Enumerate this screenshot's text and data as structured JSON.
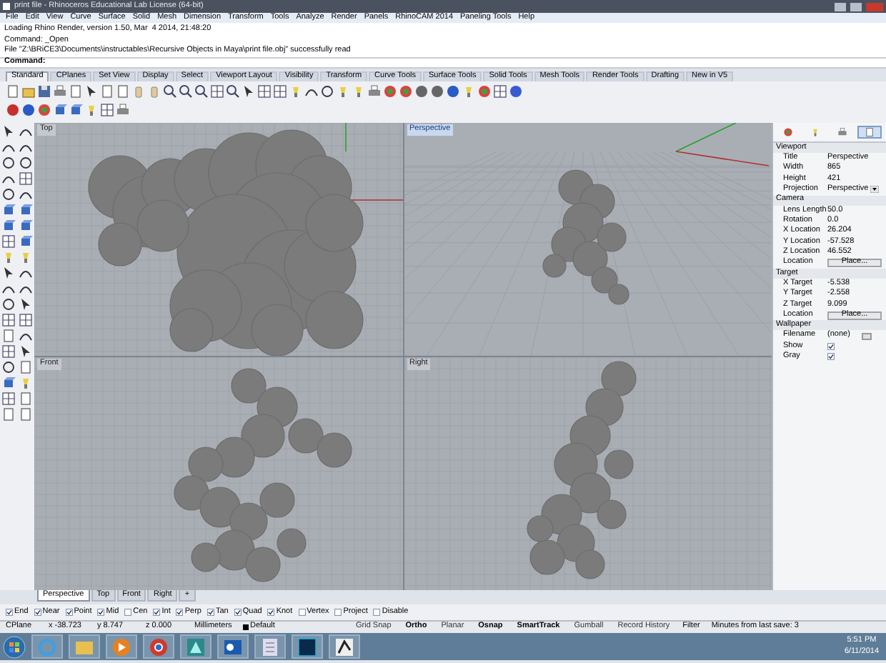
{
  "window": {
    "title": "print file - Rhinoceros Educational Lab License (64-bit)"
  },
  "menu": [
    "File",
    "Edit",
    "View",
    "Curve",
    "Surface",
    "Solid",
    "Mesh",
    "Dimension",
    "Transform",
    "Tools",
    "Analyze",
    "Render",
    "Panels",
    "RhinoCAM 2014",
    "Paneling Tools",
    "Help"
  ],
  "command_history": [
    "Loading Rhino Render, version 1.50, Mar  4 2014, 21:48:20",
    "Command: _Open",
    "File \"Z:\\BRiCE3\\Documents\\instructables\\Recursive Objects in Maya\\print file.obj\" successfully read"
  ],
  "command_prompt": "Command:",
  "toolbar_tabs": [
    {
      "label": "Standard",
      "selected": true
    },
    {
      "label": "CPlanes",
      "selected": false
    },
    {
      "label": "Set View",
      "selected": false
    },
    {
      "label": "Display",
      "selected": false
    },
    {
      "label": "Select",
      "selected": false
    },
    {
      "label": "Viewport Layout",
      "selected": false
    },
    {
      "label": "Visibility",
      "selected": false
    },
    {
      "label": "Transform",
      "selected": false
    },
    {
      "label": "Curve Tools",
      "selected": false
    },
    {
      "label": "Surface Tools",
      "selected": false
    },
    {
      "label": "Solid Tools",
      "selected": false
    },
    {
      "label": "Mesh Tools",
      "selected": false
    },
    {
      "label": "Render Tools",
      "selected": false
    },
    {
      "label": "Drafting",
      "selected": false
    },
    {
      "label": "New in V5",
      "selected": false
    }
  ],
  "viewports": [
    {
      "label": "Top",
      "active": false,
      "kind": "top"
    },
    {
      "label": "Perspective",
      "active": true,
      "kind": "perspective"
    },
    {
      "label": "Front",
      "active": false,
      "kind": "front"
    },
    {
      "label": "Right",
      "active": false,
      "kind": "right"
    }
  ],
  "properties": {
    "tabs": [
      {
        "selected": false
      },
      {
        "selected": false
      },
      {
        "selected": false
      },
      {
        "selected": true
      }
    ],
    "sections": [
      {
        "title": "Viewport",
        "rows": [
          {
            "label": "Title",
            "kind": "text",
            "value": "Perspective"
          },
          {
            "label": "Width",
            "kind": "text",
            "value": "865"
          },
          {
            "label": "Height",
            "kind": "text",
            "value": "421"
          },
          {
            "label": "Projection",
            "kind": "dropdown",
            "value": "Perspective"
          }
        ]
      },
      {
        "title": "Camera",
        "rows": [
          {
            "label": "Lens Length",
            "kind": "text",
            "value": "50.0"
          },
          {
            "label": "Rotation",
            "kind": "text",
            "value": "0.0"
          },
          {
            "label": "X Location",
            "kind": "text",
            "value": "26.204"
          },
          {
            "label": "Y Location",
            "kind": "text",
            "value": "-57.528"
          },
          {
            "label": "Z Location",
            "kind": "text",
            "value": "46.552"
          },
          {
            "label": "Location",
            "kind": "button",
            "value": "Place..."
          }
        ]
      },
      {
        "title": "Target",
        "rows": [
          {
            "label": "X Target",
            "kind": "text",
            "value": "-5.538"
          },
          {
            "label": "Y Target",
            "kind": "text",
            "value": "-2.558"
          },
          {
            "label": "Z Target",
            "kind": "text",
            "value": "9.099"
          },
          {
            "label": "Location",
            "kind": "button",
            "value": "Place..."
          }
        ]
      },
      {
        "title": "Wallpaper",
        "rows": [
          {
            "label": "Filename",
            "kind": "browse",
            "value": "(none)"
          },
          {
            "label": "Show",
            "kind": "checkbox",
            "checked": true
          },
          {
            "label": "Gray",
            "kind": "checkbox",
            "checked": true
          }
        ]
      }
    ]
  },
  "viewport_tabs": [
    {
      "label": "Perspective",
      "selected": true
    },
    {
      "label": "Top",
      "selected": false
    },
    {
      "label": "Front",
      "selected": false
    },
    {
      "label": "Right",
      "selected": false
    },
    {
      "label": "+",
      "selected": false
    }
  ],
  "osnaps": [
    {
      "label": "End",
      "checked": true
    },
    {
      "label": "Near",
      "checked": true
    },
    {
      "label": "Point",
      "checked": true
    },
    {
      "label": "Mid",
      "checked": true
    },
    {
      "label": "Cen",
      "checked": false
    },
    {
      "label": "Int",
      "checked": true
    },
    {
      "label": "Perp",
      "checked": true
    },
    {
      "label": "Tan",
      "checked": true
    },
    {
      "label": "Quad",
      "checked": true
    },
    {
      "label": "Knot",
      "checked": true
    },
    {
      "label": "Vertex",
      "checked": false
    },
    {
      "label": "Project",
      "checked": false
    },
    {
      "label": "Disable",
      "checked": false
    }
  ],
  "status_bar": {
    "cplane": "CPlane",
    "coordinates": [
      "x -38.723",
      "y 8.747",
      "z 0.000"
    ],
    "units": "Millimeters",
    "layer": {
      "name": "Default",
      "color": "#000000"
    },
    "toggles": [
      {
        "label": "Grid Snap",
        "on": false
      },
      {
        "label": "Ortho",
        "on": true
      },
      {
        "label": "Planar",
        "on": false
      },
      {
        "label": "Osnap",
        "on": true
      },
      {
        "label": "SmartTrack",
        "on": true
      },
      {
        "label": "Gumball",
        "on": false
      },
      {
        "label": "Record History",
        "on": false
      }
    ],
    "filter": "Filter",
    "save_info": "Minutes from last save: 3"
  },
  "taskbar": {
    "time": "5:51 PM",
    "date": "6/11/2014"
  }
}
